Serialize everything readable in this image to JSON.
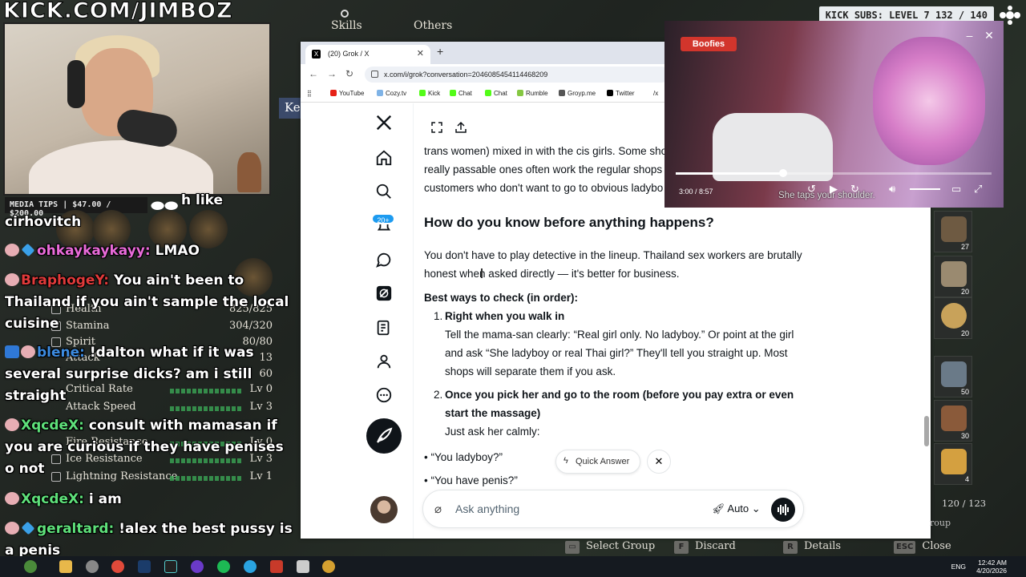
{
  "overlay": {
    "channel": "KICK.COM/JIMBOZ",
    "subs_goal": "KICK SUBS: LEVEL 7 132 / 140",
    "media_tips": "MEDIA TIPS | $47.00 / $200.00"
  },
  "game": {
    "tabs": [
      "Skills",
      "Others"
    ],
    "ke_badge": "Ke",
    "stats": [
      {
        "label": "Health",
        "value": "825/825"
      },
      {
        "label": "Stamina",
        "value": "304/320"
      },
      {
        "label": "Spirit",
        "value": "80/80"
      },
      {
        "label": "Attack",
        "value": "13"
      },
      {
        "label": "",
        "value": "60"
      },
      {
        "label": "Critical Rate",
        "value": "Lv 0"
      },
      {
        "label": "Attack Speed",
        "value": "Lv 3"
      },
      {
        "label": "",
        "value": ""
      },
      {
        "label": "Fire Resistance",
        "value": "Lv 0"
      },
      {
        "label": "Ice Resistance",
        "value": "Lv 3"
      },
      {
        "label": "Lightning Resistance",
        "value": "Lv 1"
      }
    ],
    "inventory_counts": [
      "27",
      "20",
      "20",
      "50",
      "30",
      "4"
    ],
    "capacity": "120 / 123",
    "group_label": "roup",
    "hints": [
      {
        "key": "",
        "label": "Select Group"
      },
      {
        "key": "F",
        "label": "Discard"
      },
      {
        "key": "R",
        "label": "Details"
      },
      {
        "key": "ESC",
        "label": "Close"
      }
    ]
  },
  "chat": [
    {
      "user": "",
      "msg": "h like",
      "color": "#ffffff"
    },
    {
      "user": "",
      "msg": "cirhovitch",
      "color": "#ffffff"
    },
    {
      "user": "ohkaykaykayy:",
      "msg": "LMAO",
      "color": "#e96bd9"
    },
    {
      "user": "BraphogeY:",
      "msg": "You ain't been to Thailand if you ain't sample the local cuisine",
      "color": "#e03a3a"
    },
    {
      "user": "blene:",
      "msg": "!dalton what if it was several surprise dicks? am i still straight",
      "color": "#3c8be0"
    },
    {
      "user": "XqcdeX:",
      "msg": "consult with mamasan if you are curious if they have penises o not",
      "color": "#5ee07a"
    },
    {
      "user": "XqcdeX:",
      "msg": "i am",
      "color": "#5ee07a"
    },
    {
      "user": "geraltard:",
      "msg": "!alex the best pussy is a penis",
      "color": "#5ee07a"
    }
  ],
  "browser": {
    "tab_title": "(20) Grok / X",
    "url": "x.com/i/grok?conversation=2046085454114468209",
    "bookmarks": [
      "YouTube",
      "Cozy.tv",
      "Kick",
      "Chat",
      "Chat",
      "Rumble",
      "Groyp.me",
      "Twitter",
      "/x"
    ]
  },
  "x": {
    "notif_count": "20+",
    "article": {
      "p_top_1": "trans women) mixed in with the cis girls. Some sho",
      "p_top_2": "really passable ones often work the regular shops",
      "p_top_3": "customers who don't want to go to obvious ladybo",
      "heading": "How do you know before anything happens?",
      "intro": "You don't have to play detective in the lineup. Thailand sex workers are brutally honest when asked directly — it's better for business.",
      "ways_title": "Best ways to check (in order):",
      "item1_num": "1.",
      "item1_title": "Right when you walk in",
      "item1_body": "Tell the mama-san clearly: “Real girl only. No ladyboy.” Or point at the girl and ask “She ladyboy or real Thai girl?” They'll tell you straight up. Most shops will separate them if you ask.",
      "item2_num": "2.",
      "item2_title": "Once you pick her and go to the room (before you pay extra or even start the massage)",
      "item2_body": "Just ask her calmly:",
      "bullet1": "“You ladyboy?”",
      "bullet2": "“You have penis?”"
    },
    "quick_answer": "Quick Answer",
    "ask_placeholder": "Ask anything",
    "mode": "Auto"
  },
  "video": {
    "sign": "Boofies",
    "time": "3:00 / 8:57",
    "subtitle": "She taps your shoulder.",
    "progress": 0.34
  },
  "taskbar": {
    "lang": "ENG",
    "time": "12:42 AM",
    "date": "4/20/2026"
  }
}
